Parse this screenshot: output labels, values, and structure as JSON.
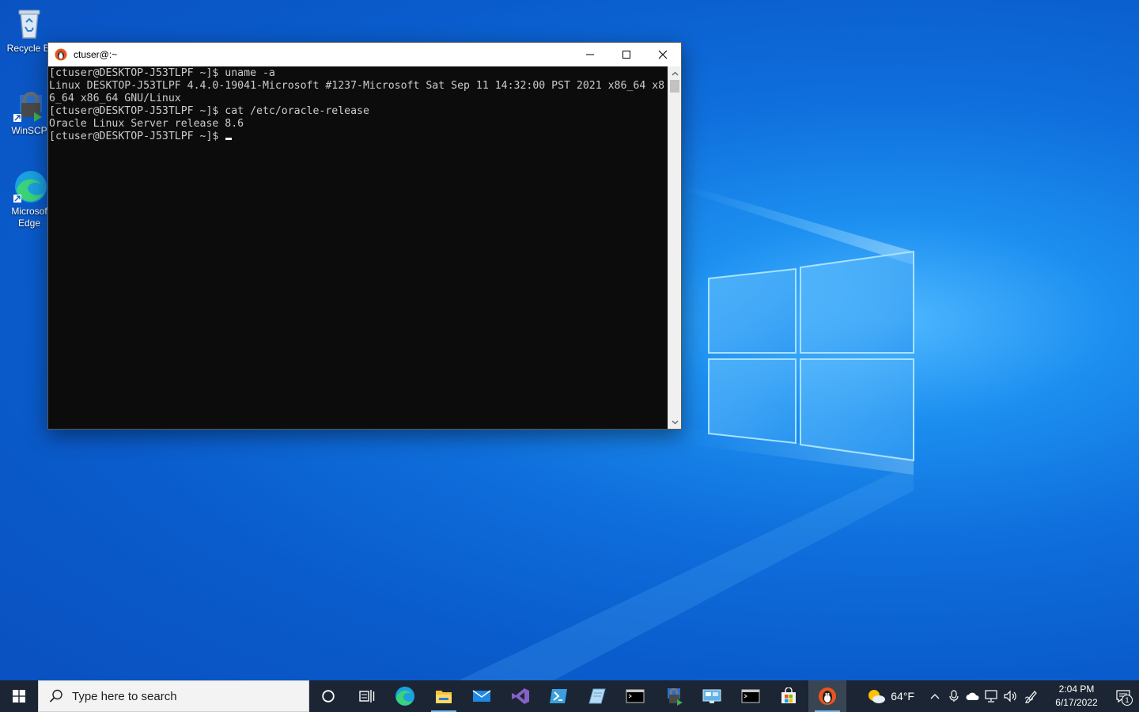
{
  "desktop": {
    "icons": [
      {
        "label": "Recycle Bi",
        "icon": "recycle-bin-icon"
      },
      {
        "label": "WinSCP",
        "icon": "winscp-icon"
      },
      {
        "label": "Microsof\nEdge",
        "icon": "edge-icon"
      }
    ]
  },
  "window": {
    "title": "ctuser@:~",
    "app_icon": "ubuntu-penguin-icon",
    "controls": {
      "minimize": "minimize-icon",
      "maximize": "maximize-icon",
      "close": "close-icon"
    }
  },
  "terminal": {
    "lines": [
      "[ctuser@DESKTOP-J53TLPF ~]$ uname -a",
      "Linux DESKTOP-J53TLPF 4.4.0-19041-Microsoft #1237-Microsoft Sat Sep 11 14:32:00 PST 2021 x86_64 x8",
      "6_64 x86_64 GNU/Linux",
      "[ctuser@DESKTOP-J53TLPF ~]$ cat /etc/oracle-release",
      "Oracle Linux Server release 8.6",
      "[ctuser@DESKTOP-J53TLPF ~]$ "
    ]
  },
  "taskbar": {
    "search_placeholder": "Type here to search",
    "weather": {
      "temp": "64°F",
      "icon": "weather-partly-sunny-icon"
    },
    "clock": {
      "time": "2:04 PM",
      "date": "6/17/2022"
    },
    "notification_count": "1"
  },
  "colors": {
    "terminal_bg": "#0c0c0c",
    "terminal_fg": "#cccccc",
    "taskbar_bg": "#1b2533",
    "running_indicator": "#76b9ed"
  }
}
